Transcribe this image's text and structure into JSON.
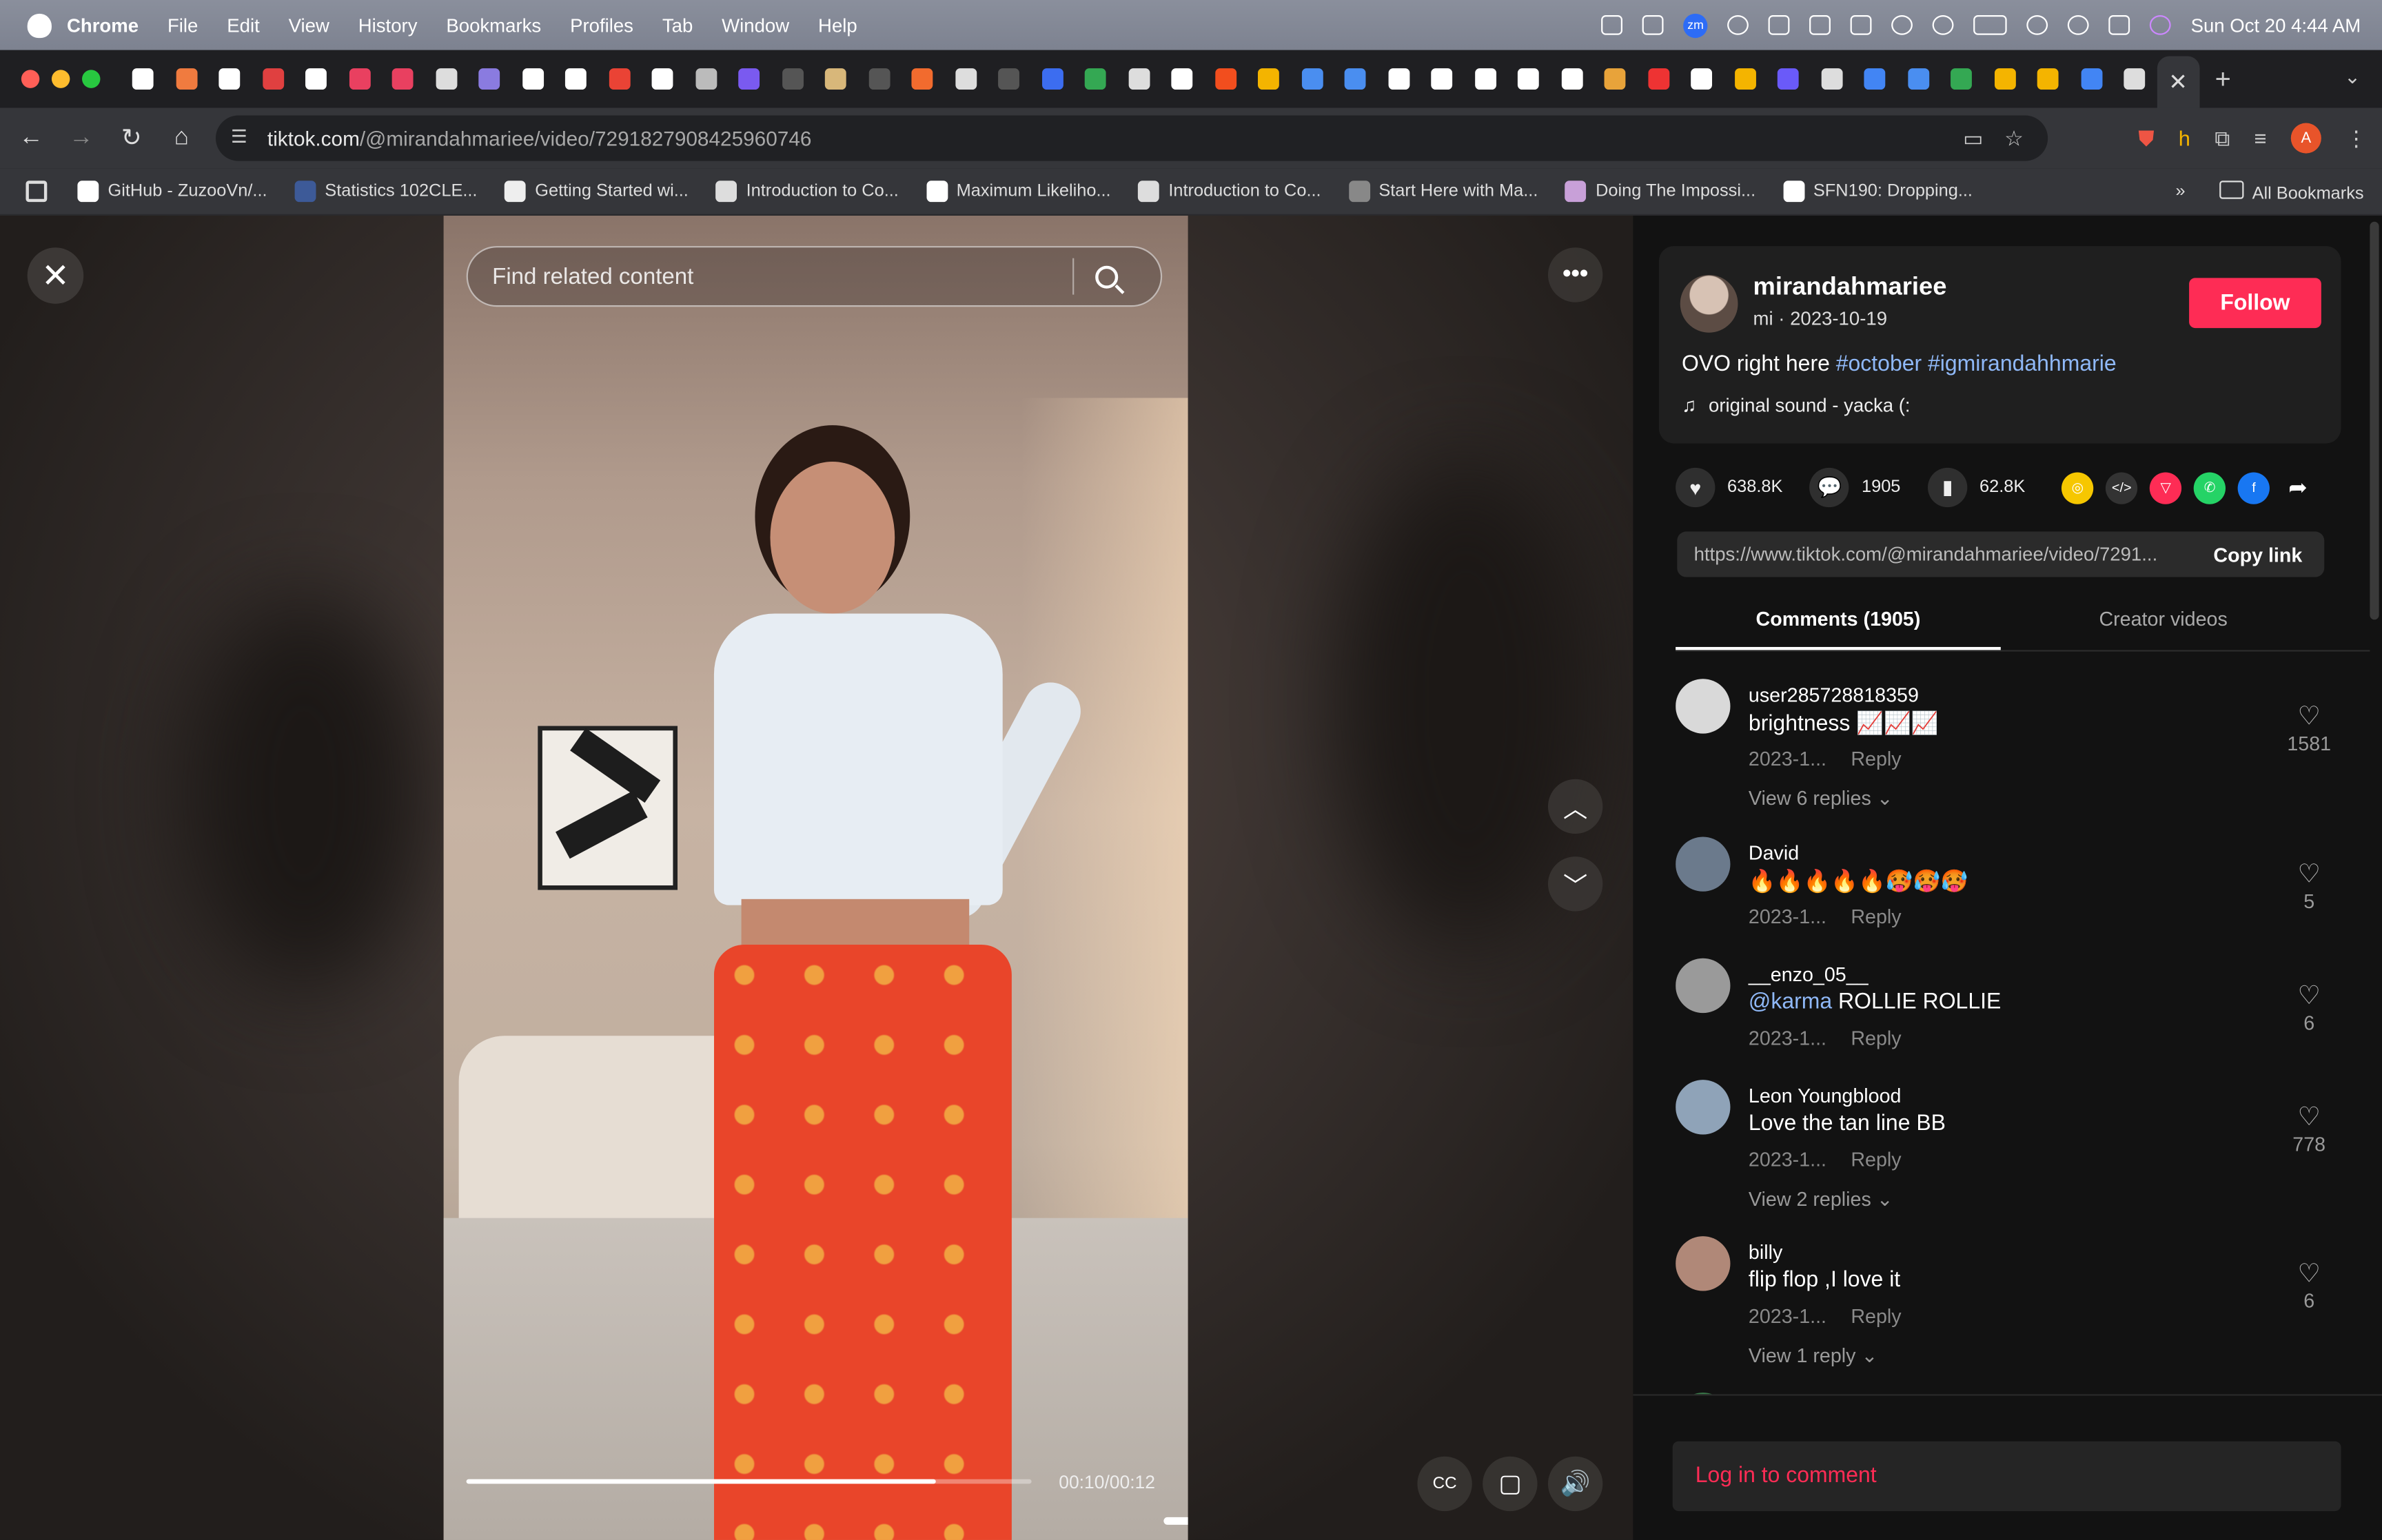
{
  "menubar": {
    "items": [
      "Chrome",
      "File",
      "Edit",
      "View",
      "History",
      "Bookmarks",
      "Profiles",
      "Tab",
      "Window",
      "Help"
    ],
    "clock": "Sun Oct 20  4:44 AM",
    "zoom_badge": "zm"
  },
  "browser": {
    "url_host": "tiktok.com",
    "url_path": "/@mirandahmariee/video/7291827908425960746",
    "profile_initial": "A",
    "bookmarks": [
      {
        "label": "GitHub - ZuzooVn/...",
        "color": "#ffffff"
      },
      {
        "label": "Statistics 102CLE...",
        "color": "#3d5a98"
      },
      {
        "label": "Getting Started wi...",
        "color": "#eeeeee"
      },
      {
        "label": "Introduction to Co...",
        "color": "#dddddd"
      },
      {
        "label": "Maximum Likeliho...",
        "color": "#ffffff"
      },
      {
        "label": "Introduction to Co...",
        "color": "#dddddd"
      },
      {
        "label": "Start Here with Ma...",
        "color": "#888888"
      },
      {
        "label": "Doing The Impossi...",
        "color": "#c8a0d8"
      },
      {
        "label": "SFN190: Dropping...",
        "color": "#ffffff"
      }
    ],
    "all_bookmarks": "All Bookmarks",
    "tab_colors": [
      "#ffffff",
      "#f07b3f",
      "#ffffff",
      "#e04040",
      "#ffffff",
      "#e94060",
      "#e94060",
      "#dddddd",
      "#8a7be0",
      "#ffffff",
      "#ffffff",
      "#ea4335",
      "#ffffff",
      "#bbbbbb",
      "#7a5af0",
      "#555555",
      "#d8b77a",
      "#555555",
      "#f26b2e",
      "#dddddd",
      "#555555",
      "#3c6df0",
      "#34a853",
      "#dddddd",
      "#ffffff",
      "#f24e1e",
      "#f4b400",
      "#4a8ef0",
      "#4a8ef0",
      "#ffffff",
      "#ffffff",
      "#ffffff",
      "#ffffff",
      "#ffffff",
      "#e8a33a",
      "#e33",
      "#ffffff",
      "#f4b400",
      "#6a5af9",
      "#dddddd",
      "#4285f4",
      "#4a8ef0",
      "#34a853",
      "#f4b400",
      "#f4b400",
      "#4285f4",
      "#dddddd"
    ]
  },
  "video": {
    "search_placeholder": "Find related content",
    "timecode": "00:10/00:12",
    "progress": 0.83
  },
  "post": {
    "username": "mirandahmariee",
    "subline": "mi · 2023-10-19",
    "follow_label": "Follow",
    "caption_text": "OVO right here ",
    "hashtag1": "#october",
    "hashtag2": "#igmirandahhmarie",
    "sound": "original sound - yacka (:",
    "likes": "638.8K",
    "comments_count": "1905",
    "saves": "62.8K",
    "link": "https://www.tiktok.com/@mirandahmariee/video/7291...",
    "copy_label": "Copy link",
    "tab_comments": "Comments (1905)",
    "tab_creator": "Creator videos",
    "login_prompt": "Log in to comment"
  },
  "comments": [
    {
      "user": "user285728818359",
      "text": "brightness 📈📈📈",
      "date": "2023-1...",
      "reply": "Reply",
      "likes": "1581",
      "view_replies": "View 6 replies"
    },
    {
      "user": "David",
      "text": "🔥🔥🔥🔥🔥🥵🥵🥵",
      "date": "2023-1...",
      "reply": "Reply",
      "likes": "5",
      "view_replies": ""
    },
    {
      "user": "__enzo_05__",
      "mention": "@karma",
      "text": " ROLLIE ROLLIE",
      "date": "2023-1...",
      "reply": "Reply",
      "likes": "6",
      "view_replies": ""
    },
    {
      "user": "Leon Youngblood",
      "text": "Love the tan line BB",
      "date": "2023-1...",
      "reply": "Reply",
      "likes": "778",
      "view_replies": "View 2 replies"
    },
    {
      "user": "billy",
      "text": "flip flop ,I love it",
      "date": "2023-1...",
      "reply": "Reply",
      "likes": "6",
      "view_replies": "View 1 reply"
    }
  ],
  "colors": {
    "accent": "#fe2c55",
    "hashtag": "#8fb8f7"
  }
}
